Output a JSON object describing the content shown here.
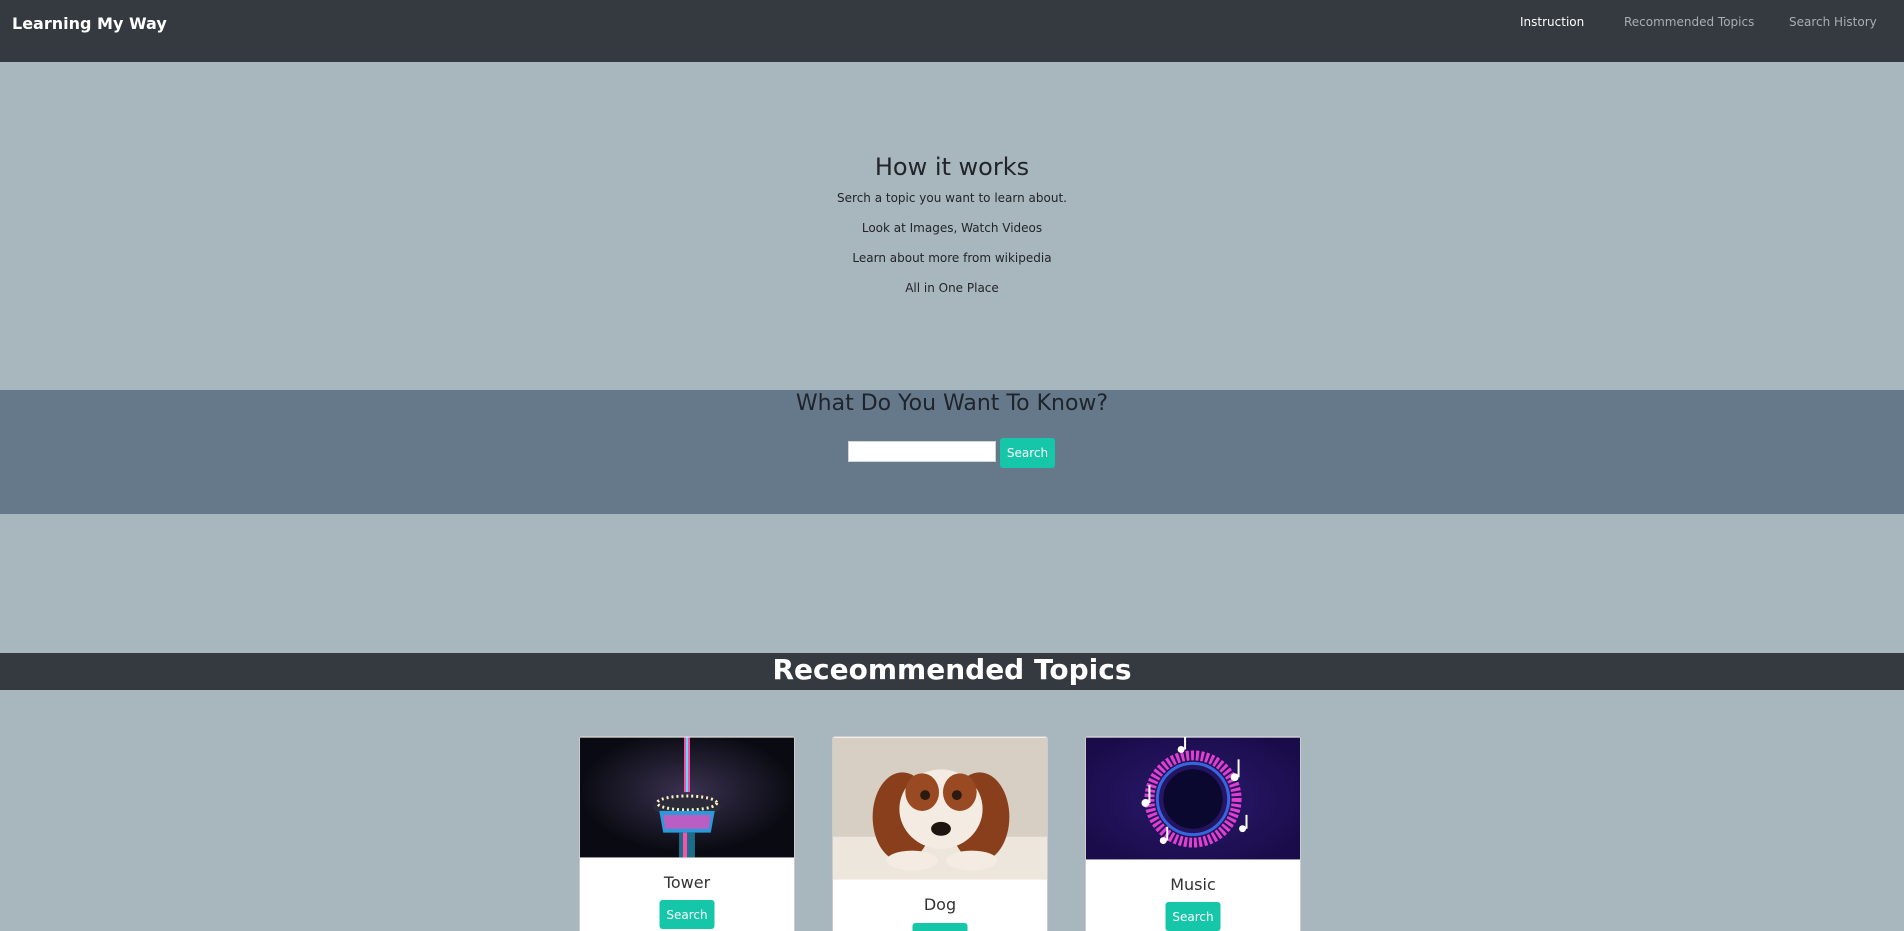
{
  "nav": {
    "brand": "Learning My Way",
    "links": [
      {
        "label": "Instruction",
        "active": true
      },
      {
        "label": "Recommended Topics",
        "active": false
      },
      {
        "label": "Search History",
        "active": false
      }
    ]
  },
  "how_it_works": {
    "title": "How it works",
    "steps": [
      "Serch a topic you want to learn about.",
      "Look at Images, Watch Videos",
      "Learn about more from wikipedia",
      "All in One Place"
    ]
  },
  "search": {
    "title": "What Do You Want To Know?",
    "input_value": "",
    "button_label": "Search"
  },
  "recommended": {
    "title": "Receommended Topics",
    "cards": [
      {
        "title": "Tower",
        "button_label": "Search",
        "image": "tower-image"
      },
      {
        "title": "Dog",
        "button_label": "Search",
        "image": "dog-image"
      },
      {
        "title": "Music",
        "button_label": "Search",
        "image": "music-image"
      }
    ]
  },
  "colors": {
    "navbar": "#343a40",
    "page_background": "#a8b6bd",
    "search_band": "#66798b",
    "accent_button": "#16c6a8"
  }
}
